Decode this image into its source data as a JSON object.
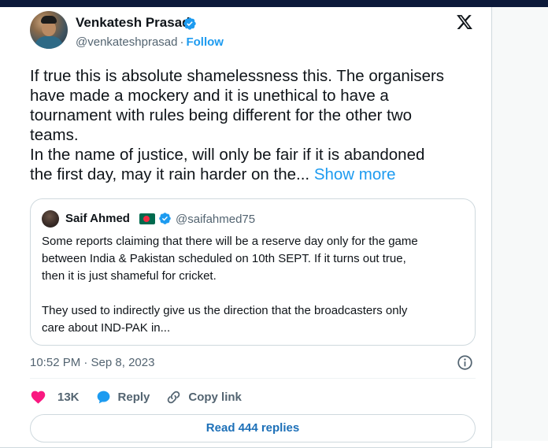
{
  "author": {
    "name": "Venkatesh Prasad",
    "handle": "@venkateshprasad",
    "separator": "·",
    "follow_label": "Follow"
  },
  "tweet": {
    "text": "If true this is absolute shamelessness this. The organisers\nhave made a mockery and it is unethical to have a\ntournament with rules being different for the other two\nteams.\nIn the name of justice, will only be fair if it is abandoned\nthe first day, may it rain harder on the...",
    "show_more_label": "Show more",
    "timestamp": "10:52 PM · Sep 8, 2023"
  },
  "quoted_tweet": {
    "name": "Saif Ahmed",
    "handle": "@saifahmed75",
    "text": "Some reports claiming that there will be a reserve day only for the game\nbetween India & Pakistan scheduled on 10th SEPT. If it turns out true,\nthen it is just shameful for cricket.\n\nThey used to indirectly give us the direction that the broadcasters only\ncare about IND-PAK in..."
  },
  "actions": {
    "like_count": "13K",
    "reply_label": "Reply",
    "copy_link_label": "Copy link"
  },
  "replies_button_label": "Read 444 replies",
  "colors": {
    "accent": "#1d9bf0",
    "like": "#f91880",
    "text_primary": "#0f1419",
    "text_secondary": "#536471",
    "border": "#cfd9de"
  },
  "icons": [
    "verified-badge-icon",
    "x-logo-icon",
    "bangladesh-flag-icon",
    "info-icon",
    "heart-icon",
    "reply-bubble-icon",
    "link-icon"
  ]
}
